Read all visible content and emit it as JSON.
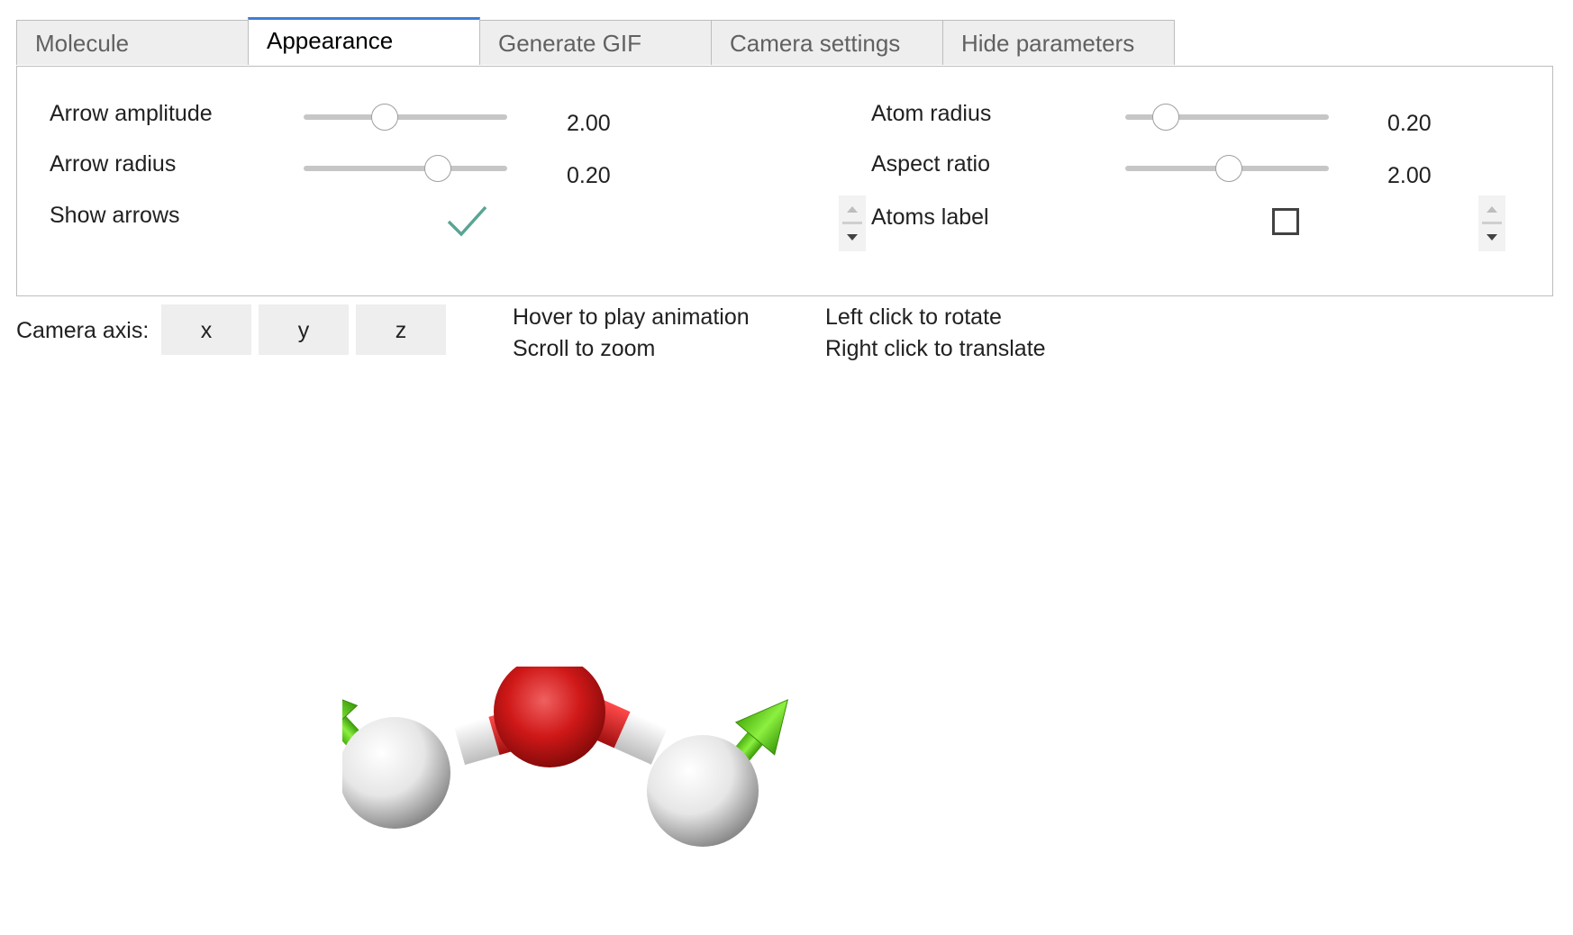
{
  "tabs": [
    {
      "label": "Molecule",
      "active": false
    },
    {
      "label": "Appearance",
      "active": true
    },
    {
      "label": "Generate GIF",
      "active": false
    },
    {
      "label": "Camera settings",
      "active": false
    },
    {
      "label": "Hide parameters",
      "active": false
    }
  ],
  "appearance": {
    "arrow_amplitude": {
      "label": "Arrow amplitude",
      "value": "2.00",
      "fraction": 0.4
    },
    "arrow_radius": {
      "label": "Arrow radius",
      "value": "0.20",
      "fraction": 0.66
    },
    "show_arrows": {
      "label": "Show arrows",
      "checked": true
    },
    "atom_radius": {
      "label": "Atom radius",
      "value": "0.20",
      "fraction": 0.2
    },
    "aspect_ratio": {
      "label": "Aspect ratio",
      "value": "2.00",
      "fraction": 0.51
    },
    "atoms_label": {
      "label": "Atoms label",
      "checked": false
    }
  },
  "camera": {
    "label": "Camera axis:",
    "buttons": [
      "x",
      "y",
      "z"
    ]
  },
  "hints": {
    "hover": "Hover to play animation",
    "scroll": "Scroll to zoom",
    "left_click": "Left click to rotate",
    "right_click": "Right click to translate"
  },
  "colors": {
    "accent": "#3f7ed5",
    "check": "#5aa595",
    "oxygen": "#d01818",
    "hydrogen": "#e6e6e6",
    "arrow": "#6ee020"
  }
}
